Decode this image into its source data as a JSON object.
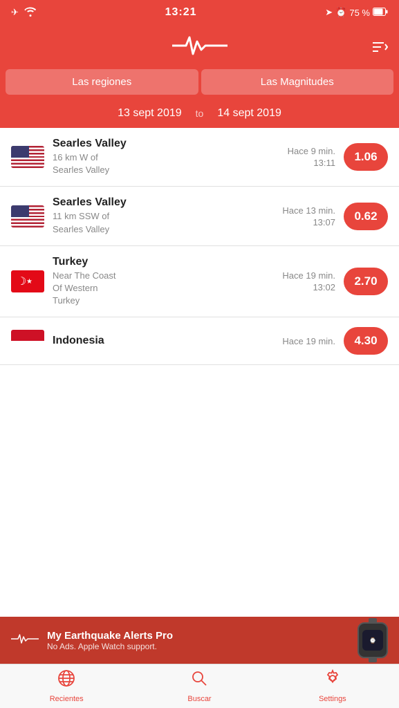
{
  "status": {
    "time": "13:21",
    "battery": "75 %"
  },
  "header": {
    "sort_label": "sort"
  },
  "filters": {
    "regions_label": "Las regiones",
    "magnitudes_label": "Las Magnitudes"
  },
  "date_range": {
    "from": "13 sept 2019",
    "to_label": "to",
    "to": "14 sept 2019"
  },
  "earthquakes": [
    {
      "country": "USA",
      "location": "Searles Valley",
      "region": "16 km W of\nSearles Valley",
      "ago": "Hace 9 min.",
      "time": "13:11",
      "magnitude": "1.06"
    },
    {
      "country": "USA",
      "location": "Searles Valley",
      "region": "11 km SSW of\nSearles Valley",
      "ago": "Hace 13 min.",
      "time": "13:07",
      "magnitude": "0.62"
    },
    {
      "country": "Turkey",
      "location": "Turkey",
      "region": "Near The Coast\nOf Western\nTurkey",
      "ago": "Hace 19 min.",
      "time": "13:02",
      "magnitude": "2.70"
    },
    {
      "country": "Indonesia",
      "location": "Indonesia",
      "region": "",
      "ago": "Hace 19 min.",
      "time": "",
      "magnitude": "4.30"
    }
  ],
  "promo": {
    "title": "My Earthquake Alerts Pro",
    "subtitle": "No Ads. Apple Watch support."
  },
  "tabs": [
    {
      "label": "Recientes",
      "icon": "globe"
    },
    {
      "label": "Buscar",
      "icon": "search"
    },
    {
      "label": "Settings",
      "icon": "gear"
    }
  ]
}
